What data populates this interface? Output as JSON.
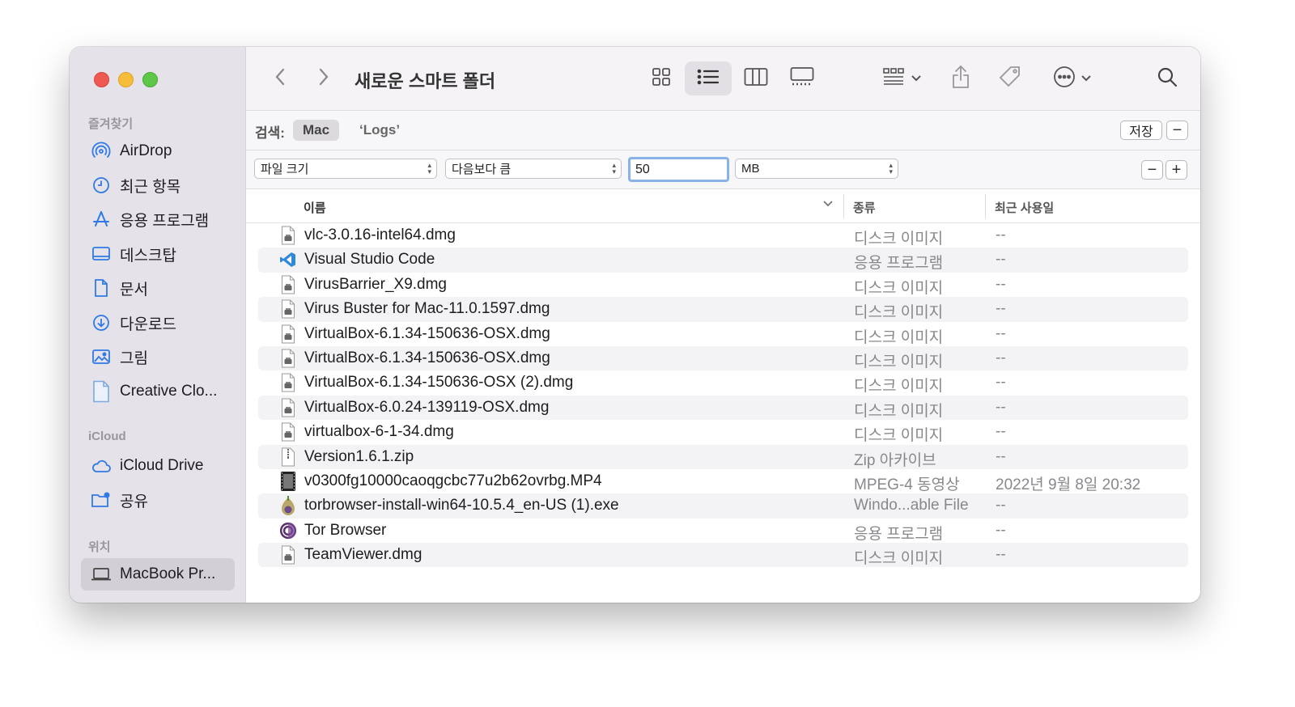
{
  "window": {
    "title": "새로운 스마트 폴더"
  },
  "sidebar": {
    "sections": [
      {
        "title": "즐겨찾기",
        "items": [
          {
            "label": "AirDrop",
            "icon": "airdrop-icon"
          },
          {
            "label": "최근 항목",
            "icon": "clock-icon"
          },
          {
            "label": "응용 프로그램",
            "icon": "applications-icon"
          },
          {
            "label": "데스크탑",
            "icon": "desktop-icon"
          },
          {
            "label": "문서",
            "icon": "document-icon"
          },
          {
            "label": "다운로드",
            "icon": "download-icon"
          },
          {
            "label": "그림",
            "icon": "photo-icon"
          },
          {
            "label": "Creative Clo...",
            "icon": "file-icon"
          }
        ]
      },
      {
        "title": "iCloud",
        "items": [
          {
            "label": "iCloud Drive",
            "icon": "cloud-icon"
          },
          {
            "label": "공유",
            "icon": "shared-folder-icon"
          }
        ]
      },
      {
        "title": "위치",
        "items": [
          {
            "label": "MacBook Pr...",
            "icon": "laptop-icon",
            "selected": true
          }
        ]
      }
    ]
  },
  "search": {
    "label": "검색:",
    "scope_selected": "Mac",
    "scope_other": "‘Logs’",
    "save_label": "저장",
    "remove_label": "−"
  },
  "filter": {
    "attribute": "파일 크기",
    "operator": "다음보다 큼",
    "value": "50",
    "unit": "MB",
    "remove_label": "−",
    "add_label": "+"
  },
  "columns": {
    "name": "이름",
    "kind": "종류",
    "date": "최근 사용일"
  },
  "files": [
    {
      "name": "vlc-3.0.16-intel64.dmg",
      "kind": "디스크 이미지",
      "date": "--",
      "icon": "disk-image-icon"
    },
    {
      "name": "Visual Studio Code",
      "kind": "응용 프로그램",
      "date": "--",
      "icon": "vscode-icon"
    },
    {
      "name": "VirusBarrier_X9.dmg",
      "kind": "디스크 이미지",
      "date": "--",
      "icon": "disk-image-icon"
    },
    {
      "name": "Virus Buster for Mac-11.0.1597.dmg",
      "kind": "디스크 이미지",
      "date": "--",
      "icon": "disk-image-icon"
    },
    {
      "name": "VirtualBox-6.1.34-150636-OSX.dmg",
      "kind": "디스크 이미지",
      "date": "--",
      "icon": "disk-image-icon"
    },
    {
      "name": "VirtualBox-6.1.34-150636-OSX.dmg",
      "kind": "디스크 이미지",
      "date": "--",
      "icon": "disk-image-icon"
    },
    {
      "name": "VirtualBox-6.1.34-150636-OSX (2).dmg",
      "kind": "디스크 이미지",
      "date": "--",
      "icon": "disk-image-icon"
    },
    {
      "name": "VirtualBox-6.0.24-139119-OSX.dmg",
      "kind": "디스크 이미지",
      "date": "--",
      "icon": "disk-image-icon"
    },
    {
      "name": "virtualbox-6-1-34.dmg",
      "kind": "디스크 이미지",
      "date": "--",
      "icon": "disk-image-icon"
    },
    {
      "name": "Version1.6.1.zip",
      "kind": "Zip 아카이브",
      "date": "--",
      "icon": "zip-icon"
    },
    {
      "name": "v0300fg10000caoqgcbc77u2b62ovrbg.MP4",
      "kind": "MPEG-4 동영상",
      "date": "2022년 9월 8일 20:32",
      "icon": "video-icon"
    },
    {
      "name": "torbrowser-install-win64-10.5.4_en-US (1).exe",
      "kind": "Windo...able File",
      "date": "--",
      "icon": "exe-icon"
    },
    {
      "name": "Tor Browser",
      "kind": "응용 프로그램",
      "date": "--",
      "icon": "tor-browser-icon"
    },
    {
      "name": "TeamViewer.dmg",
      "kind": "디스크 이미지",
      "date": "--",
      "icon": "disk-image-icon"
    }
  ],
  "colors": {
    "sidebar_bg": "#e6e2e9",
    "selection": "#d3cfd7",
    "accent_blue": "#2f7ae5",
    "focus_ring": "#89b3e8"
  }
}
